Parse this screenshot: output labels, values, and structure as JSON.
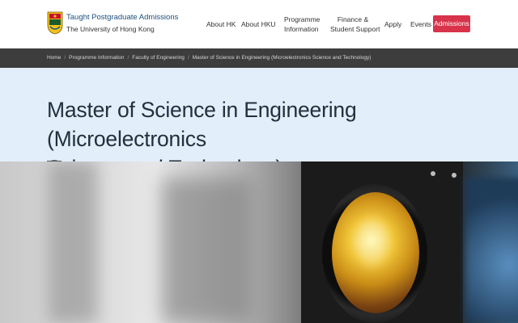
{
  "header": {
    "brand_title": "Taught Postgraduate Admissions",
    "brand_subtitle": "The University of Hong Kong",
    "logo_icon": "hku-crest-icon",
    "nav": {
      "about_hk": "About HK",
      "about_hku": "About HKU",
      "programme_line1": "Programme",
      "programme_line2": "Information",
      "finance_line1": "Finance &",
      "finance_line2": "Student Support",
      "apply": "Apply",
      "events": "Events",
      "admissions": "Admissions"
    },
    "accent_color": "#d8334a",
    "brand_color": "#1d4f7c"
  },
  "breadcrumb": {
    "items": [
      "Home",
      "Programme Information",
      "Faculty of Engineering",
      "Master of Science in Engineering (Microelectronics Science and Technology)"
    ],
    "separator": "/"
  },
  "page": {
    "title_line1": "Master of Science in Engineering (Microelectronics",
    "title_line2": "Science and Technology)",
    "band_color": "#e2eefa"
  }
}
